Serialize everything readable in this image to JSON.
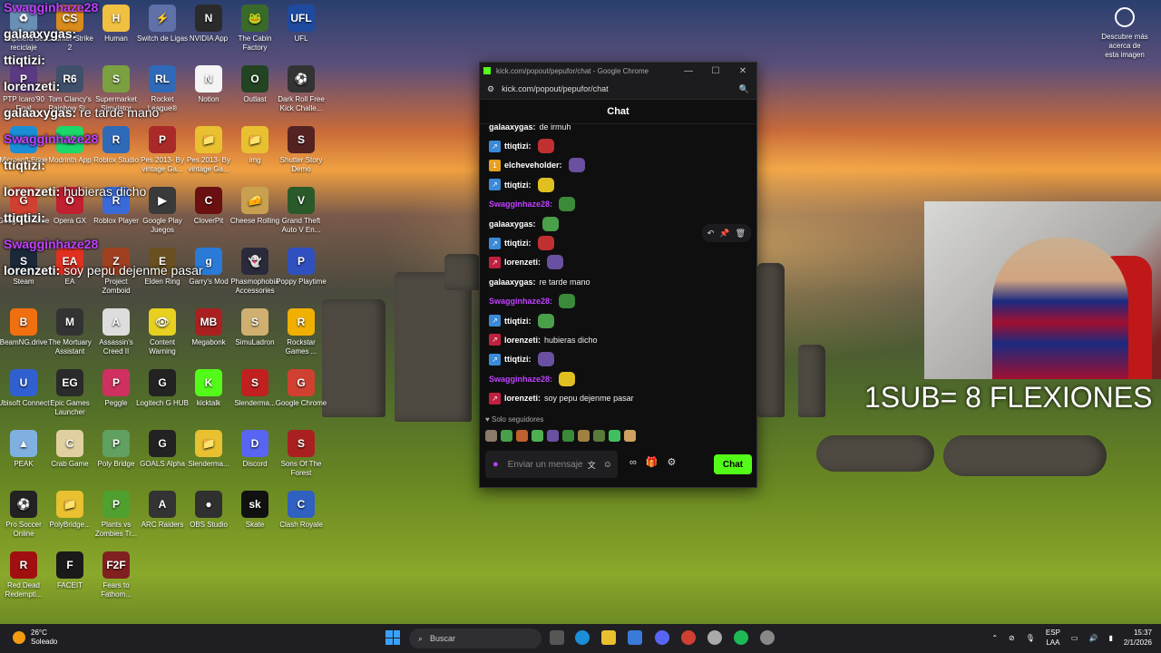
{
  "desktop_icons": [
    {
      "label": "Papelera de reciclaje",
      "color": "#6a8fb5",
      "glyph": "♻"
    },
    {
      "label": "Counter-Strike 2",
      "color": "#d98b1b",
      "glyph": "CS"
    },
    {
      "label": "Human",
      "color": "#f0c040",
      "glyph": "H"
    },
    {
      "label": "Switch de Ligas",
      "color": "#6070a8",
      "glyph": "⚡"
    },
    {
      "label": "NVIDIA App",
      "color": "#2b2b2b",
      "glyph": "N"
    },
    {
      "label": "The Cabin Factory",
      "color": "#3a6a2a",
      "glyph": "🐸"
    },
    {
      "label": "UFL",
      "color": "#1e4aa0",
      "glyph": "UFL"
    },
    {
      "label": "PTP Icaro'90 Final",
      "color": "#5a3a80",
      "glyph": "P"
    },
    {
      "label": "Tom Clancy's Rainbow Si...",
      "color": "#40506a",
      "glyph": "R6"
    },
    {
      "label": "Supermarket Simulator",
      "color": "#7aa040",
      "glyph": "S"
    },
    {
      "label": "Rocket League®",
      "color": "#2f6ab8",
      "glyph": "RL"
    },
    {
      "label": "Notion",
      "color": "#f4f4f4",
      "glyph": "N"
    },
    {
      "label": "Outlast",
      "color": "#224422",
      "glyph": "O"
    },
    {
      "label": "Dark Roll Free Kick Challe...",
      "color": "#333",
      "glyph": "⚽"
    },
    {
      "label": "Microsoft Edge",
      "color": "#1a8fd8",
      "glyph": "e"
    },
    {
      "label": "Modrinth App",
      "color": "#1bd96a",
      "glyph": "M"
    },
    {
      "label": "Roblox Studio",
      "color": "#2f6ab8",
      "glyph": "R"
    },
    {
      "label": "Pes 2013- By vintage Ga...",
      "color": "#aa2a2a",
      "glyph": "P"
    },
    {
      "label": "Pes 2013- By vintage Ga...",
      "color": "#e8c030",
      "glyph": "📁"
    },
    {
      "label": "img",
      "color": "#e8c030",
      "glyph": "📁"
    },
    {
      "label": "Shutter Story Demo",
      "color": "#552222",
      "glyph": "S"
    },
    {
      "label": "Google Chrome",
      "color": "#d04030",
      "glyph": "G"
    },
    {
      "label": "Opera GX",
      "color": "#c02030",
      "glyph": "O"
    },
    {
      "label": "Roblox Player",
      "color": "#3a6ad8",
      "glyph": "R"
    },
    {
      "label": "Google Play Juegos",
      "color": "#3a3a3a",
      "glyph": "▶"
    },
    {
      "label": "CloverPit",
      "color": "#6a1010",
      "glyph": "C"
    },
    {
      "label": "Cheese Rolling",
      "color": "#c8a050",
      "glyph": "🧀"
    },
    {
      "label": "Grand Theft Auto V En...",
      "color": "#2a5a2a",
      "glyph": "V"
    },
    {
      "label": "Steam",
      "color": "#1b2838",
      "glyph": "S"
    },
    {
      "label": "EA",
      "color": "#e03020",
      "glyph": "EA"
    },
    {
      "label": "Project Zomboid",
      "color": "#a04020",
      "glyph": "Z"
    },
    {
      "label": "Elden Ring",
      "color": "#6a5020",
      "glyph": "E"
    },
    {
      "label": "Garry's Mod",
      "color": "#2a7ad8",
      "glyph": "g"
    },
    {
      "label": "Phasmophobia Accessories",
      "color": "#2a2a3a",
      "glyph": "👻"
    },
    {
      "label": "Poppy Playtime",
      "color": "#3050c0",
      "glyph": "P"
    },
    {
      "label": "BeamNG.drive",
      "color": "#f07010",
      "glyph": "B"
    },
    {
      "label": "The Mortuary Assistant",
      "color": "#333",
      "glyph": "M"
    },
    {
      "label": "Assassin's Creed II",
      "color": "#ddd",
      "glyph": "A"
    },
    {
      "label": "Content Warning",
      "color": "#e8d020",
      "glyph": "👁"
    },
    {
      "label": "Megabonk",
      "color": "#aa2020",
      "glyph": "MB"
    },
    {
      "label": "SimuLadron",
      "color": "#d0b070",
      "glyph": "S"
    },
    {
      "label": "Rockstar Games ...",
      "color": "#f0b000",
      "glyph": "R"
    },
    {
      "label": "Ubisoft Connect",
      "color": "#3060d0",
      "glyph": "U"
    },
    {
      "label": "Epic Games Launcher",
      "color": "#2a2a2a",
      "glyph": "EG"
    },
    {
      "label": "Peggle",
      "color": "#d03060",
      "glyph": "P"
    },
    {
      "label": "Logitech G HUB",
      "color": "#222",
      "glyph": "G"
    },
    {
      "label": "kicktalk",
      "color": "#53fc18",
      "glyph": "K"
    },
    {
      "label": "Slenderma...",
      "color": "#c02020",
      "glyph": "S"
    },
    {
      "label": "Google Chrome",
      "color": "#d04030",
      "glyph": "G"
    },
    {
      "label": "PEAK",
      "color": "#80b0e0",
      "glyph": "▲"
    },
    {
      "label": "Crab Game",
      "color": "#e0d0a0",
      "glyph": "C"
    },
    {
      "label": "Poly Bridge",
      "color": "#60a060",
      "glyph": "P"
    },
    {
      "label": "GOALS Alpha",
      "color": "#222",
      "glyph": "G"
    },
    {
      "label": "Slenderma...",
      "color": "#e8c030",
      "glyph": "📁"
    },
    {
      "label": "Discord",
      "color": "#5865f2",
      "glyph": "D"
    },
    {
      "label": "Sons Of The Forest",
      "color": "#aa2020",
      "glyph": "S"
    },
    {
      "label": "Pro Soccer Online",
      "color": "#222",
      "glyph": "⚽"
    },
    {
      "label": "PolyBridge...",
      "color": "#e8c030",
      "glyph": "📁"
    },
    {
      "label": "Plants vs Zombies Tr...",
      "color": "#50a030",
      "glyph": "P"
    },
    {
      "label": "ARC Raiders",
      "color": "#333",
      "glyph": "A"
    },
    {
      "label": "OBS Studio",
      "color": "#303030",
      "glyph": "●"
    },
    {
      "label": "Skate",
      "color": "#111",
      "glyph": "sk"
    },
    {
      "label": "Clash Royale",
      "color": "#3060c0",
      "glyph": "C"
    },
    {
      "label": "Red Dead Redempti...",
      "color": "#a01010",
      "glyph": "R"
    },
    {
      "label": "FACEIT",
      "color": "#1a1a1a",
      "glyph": "F"
    },
    {
      "label": "Fears to Fathom...",
      "color": "#802020",
      "glyph": "F2F"
    }
  ],
  "overlay_chat": [
    {
      "user": "Swagginhaze28",
      "text": "",
      "color": "#c040ff"
    },
    {
      "user": "galaaxygas:",
      "text": "",
      "color": "#fff"
    },
    {
      "user": "ttiqtizi:",
      "text": "",
      "color": "#fff"
    },
    {
      "user": "lorenzeti:",
      "text": "",
      "color": "#fff"
    },
    {
      "user": "galaaxygas:",
      "text": "re tarde mano",
      "color": "#fff"
    },
    {
      "user": "Swagginhaze28",
      "text": "",
      "color": "#c040ff"
    },
    {
      "user": "ttiqtizi:",
      "text": "",
      "color": "#fff"
    },
    {
      "user": "lorenzeti:",
      "text": "hubieras dicho",
      "color": "#fff"
    },
    {
      "user": "ttiqtizi:",
      "text": "",
      "color": "#fff"
    },
    {
      "user": "Swagginhaze28",
      "text": "",
      "color": "#c040ff"
    },
    {
      "user": "lorenzeti:",
      "text": "soy pepu dejenme pasar",
      "color": "#fff"
    }
  ],
  "browser": {
    "title": "kick.com/popout/pepufor/chat - Google Chrome",
    "url": "kick.com/popout/pepufor/chat",
    "chat_header": "Chat",
    "messages": [
      {
        "user": "galaaxygas:",
        "text": "de irmuh",
        "color": "#fff",
        "badge": "",
        "badge_color": ""
      },
      {
        "user": "ttiqtizi:",
        "text": "",
        "color": "#fff",
        "badge": "↗",
        "badge_color": "#3a8ad8"
      },
      {
        "user": "elcheveholder:",
        "text": "",
        "color": "#fff",
        "badge": "1",
        "badge_color": "#e8a020"
      },
      {
        "user": "ttiqtizi:",
        "text": "",
        "color": "#fff",
        "badge": "↗",
        "badge_color": "#3a8ad8"
      },
      {
        "user": "Swagginhaze28:",
        "text": "",
        "color": "#c040ff",
        "badge": "",
        "badge_color": ""
      },
      {
        "user": "galaaxygas:",
        "text": "",
        "color": "#fff",
        "badge": "",
        "badge_color": ""
      },
      {
        "user": "ttiqtizi:",
        "text": "",
        "color": "#fff",
        "badge": "↗",
        "badge_color": "#3a8ad8"
      },
      {
        "user": "lorenzeti:",
        "text": "",
        "color": "#fff",
        "badge": "↗",
        "badge_color": "#c02040"
      },
      {
        "user": "galaaxygas:",
        "text": "re tarde mano",
        "color": "#fff",
        "badge": "",
        "badge_color": ""
      },
      {
        "user": "Swagginhaze28:",
        "text": "",
        "color": "#c040ff",
        "badge": "",
        "badge_color": ""
      },
      {
        "user": "ttiqtizi:",
        "text": "",
        "color": "#fff",
        "badge": "↗",
        "badge_color": "#3a8ad8"
      },
      {
        "user": "lorenzeti:",
        "text": "hubieras dicho",
        "color": "#fff",
        "badge": "↗",
        "badge_color": "#c02040"
      },
      {
        "user": "ttiqtizi:",
        "text": "",
        "color": "#fff",
        "badge": "↗",
        "badge_color": "#3a8ad8"
      },
      {
        "user": "Swagginhaze28:",
        "text": "",
        "color": "#c040ff",
        "badge": "",
        "badge_color": ""
      },
      {
        "user": "lorenzeti:",
        "text": "soy pepu dejenme pasar",
        "color": "#fff",
        "badge": "↗",
        "badge_color": "#c02040"
      }
    ],
    "followers_only": "Solo seguidores",
    "input_placeholder": "Enviar un mensaje",
    "send_label": "Chat"
  },
  "stream_overlay": {
    "sub_text": "1SUB= 8 FLEXIONES"
  },
  "about_image": "Descubre más acerca de esta imagen",
  "taskbar": {
    "weather_temp": "26°C",
    "weather_desc": "Soleado",
    "search_placeholder": "Buscar",
    "lang_line1": "ESP",
    "lang_line2": "LAA",
    "time": "15:37",
    "date": "2/1/2026",
    "accent": "#3aa0ff"
  }
}
